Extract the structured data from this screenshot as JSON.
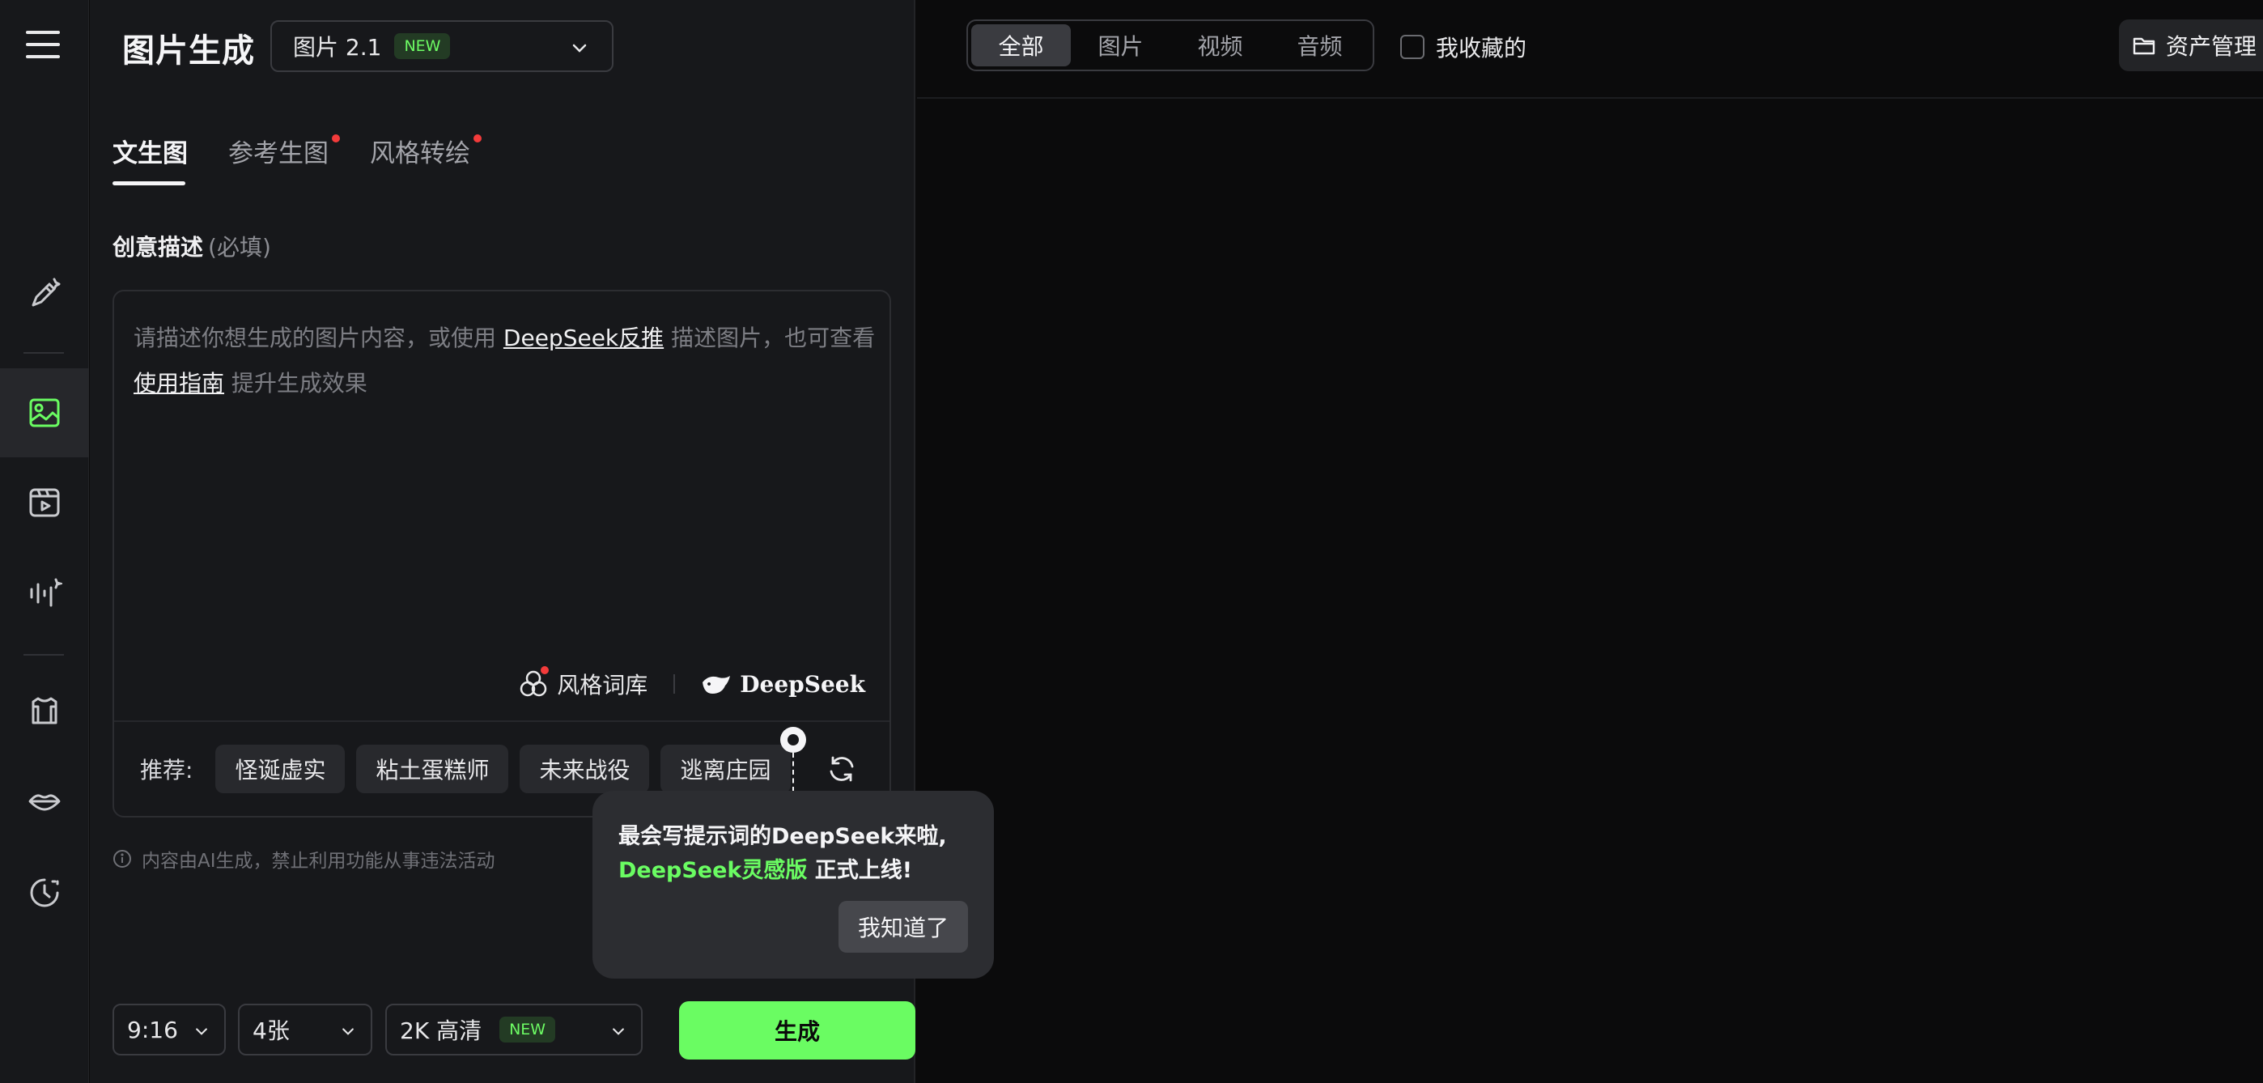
{
  "header": {
    "title": "图片生成",
    "model_label": "图片 2.1",
    "model_badge": "NEW"
  },
  "tabs": [
    {
      "label": "文生图",
      "active": true,
      "dot": false
    },
    {
      "label": "参考生图",
      "active": false,
      "dot": true
    },
    {
      "label": "风格转绘",
      "active": false,
      "dot": true
    }
  ],
  "prompt": {
    "label": "创意描述",
    "optional": "(必填)",
    "placeholder_part1": "请描述你想生成的图片内容，或使用",
    "link1": "DeepSeek反推",
    "placeholder_part2": "描述图片，也可查看",
    "link2": "使用指南",
    "placeholder_part3": "提升生成效果",
    "style_library": "风格词库",
    "deepseek_label": "DeepSeek"
  },
  "recommend": {
    "label": "推荐:",
    "chips": [
      "怪诞虚实",
      "粘土蛋糕师",
      "未来战役",
      "逃离庄园"
    ]
  },
  "notice": "内容由AI生成，禁止利用功能从事违法活动",
  "bottom": {
    "ratio": "9:16",
    "count": "4张",
    "quality": "2K 高清",
    "quality_badge": "NEW",
    "generate": "生成"
  },
  "popover": {
    "line1": "最会写提示词的DeepSeek来啦,",
    "highlight": "DeepSeek灵感版",
    "line2_rest": "正式上线!",
    "ok": "我知道了"
  },
  "filter": {
    "segments": [
      "全部",
      "图片",
      "视频",
      "音频"
    ],
    "active_index": 0,
    "favorites": "我收藏的",
    "assets": "资产管理"
  },
  "colors": {
    "accent": "#6afc62",
    "dot": "#f33b3b",
    "panel": "#17181b",
    "canvas": "#0b0b0c"
  }
}
